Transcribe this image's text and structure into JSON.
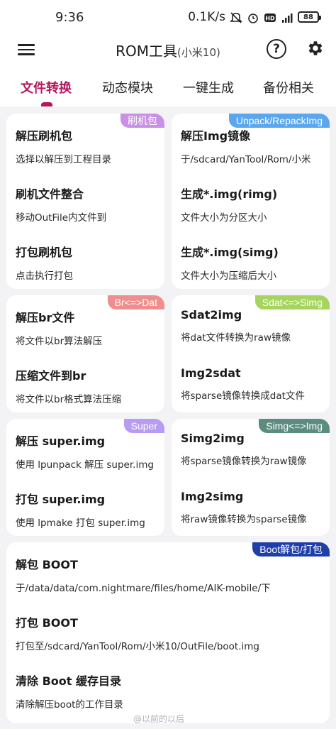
{
  "status_bar": {
    "time": "9:36",
    "net_speed": "0.1K/s",
    "battery": "88",
    "signal_label": "5G"
  },
  "app_bar": {
    "title": "ROM工具",
    "subtitle": "(小米10)",
    "help_symbol": "?"
  },
  "tabs": [
    {
      "label": "文件转换",
      "active": true
    },
    {
      "label": "动态模块",
      "active": false
    },
    {
      "label": "一键生成",
      "active": false
    },
    {
      "label": "备份相关",
      "active": false
    }
  ],
  "colors": {
    "accent": "#b5175c",
    "badge_flash": "#c990e6",
    "badge_unpack": "#5aa7ee",
    "badge_br": "#ef8e8e",
    "badge_sdat": "#a6d45e",
    "badge_super": "#b79cf2",
    "badge_simg": "#5c8c80",
    "badge_boot": "#1f3fa8"
  },
  "cards": {
    "flash": {
      "badge": "刷机包",
      "items": [
        {
          "title": "解压刷机包",
          "desc": "选择以解压到工程目录"
        },
        {
          "title": "刷机文件整合",
          "desc": "移动OutFile内文件到"
        },
        {
          "title": "打包刷机包",
          "desc": "点击执行打包"
        }
      ]
    },
    "unpack": {
      "badge": "Unpack/RepackImg",
      "items": [
        {
          "title": "解压Img镜像",
          "desc": "于/sdcard/YanTool/Rom/小米"
        },
        {
          "title": "生成*.img(rimg)",
          "desc": "文件大小为分区大小"
        },
        {
          "title": "生成*.img(simg)",
          "desc": "文件大小为压缩后大小"
        }
      ]
    },
    "br": {
      "badge": "Br<=>Dat",
      "items": [
        {
          "title": "解压br文件",
          "desc": "将文件以br算法解压"
        },
        {
          "title": "压缩文件到br",
          "desc": "将文件以br格式算法压缩"
        }
      ]
    },
    "sdat": {
      "badge": "Sdat<=>Simg",
      "items": [
        {
          "title": "Sdat2img",
          "desc": "将dat文件转换为raw镜像"
        },
        {
          "title": "Img2sdat",
          "desc": "将sparse镜像转换成dat文件"
        }
      ]
    },
    "super": {
      "badge": "Super",
      "items": [
        {
          "title": "解压 super.img",
          "desc": "使用 lpunpack 解压 super.img"
        },
        {
          "title": "打包 super.img",
          "desc": "使用 lpmake 打包 super.img"
        }
      ]
    },
    "simg": {
      "badge": "Simg<=>Img",
      "items": [
        {
          "title": "Simg2img",
          "desc": "将sparse镜像转换为raw镜像"
        },
        {
          "title": "Img2simg",
          "desc": "将raw镜像转换为sparse镜像"
        }
      ]
    },
    "boot": {
      "badge": "Boot解包/打包",
      "items": [
        {
          "title": "解包 BOOT",
          "desc": "于/data/data/com.nightmare/files/home/AIK-mobile/下"
        },
        {
          "title": "打包 BOOT",
          "desc": "打包至/sdcard/YanTool/Rom/小米10/OutFile/boot.img"
        },
        {
          "title": "清除 Boot 缓存目录",
          "desc": "清除解压boot的工作目录"
        }
      ]
    }
  },
  "watermark": "@以前的以后"
}
